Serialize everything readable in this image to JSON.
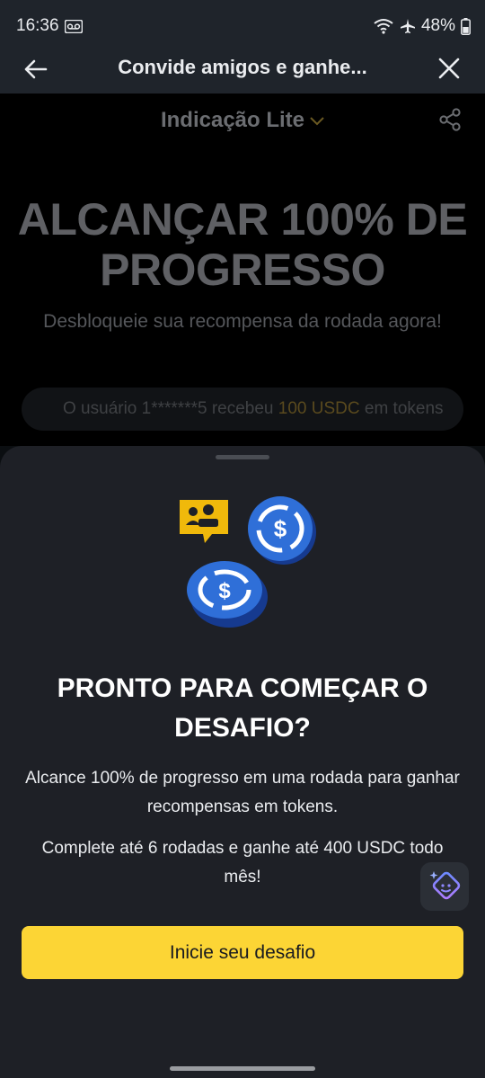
{
  "status_bar": {
    "time": "16:36",
    "battery": "48%"
  },
  "header": {
    "title": "Convide amigos e ganhe..."
  },
  "background": {
    "program_label": "Indicação Lite",
    "hero_title_line1": "ALCANÇAR 100% DE",
    "hero_title_line2": "PROGRESSO",
    "hero_subtitle": "Desbloqueie sua recompensa da rodada agora!",
    "ticker": {
      "prefix": "O usuário 1*******5 recebeu ",
      "amount": "100 USDC",
      "suffix": " em tokens"
    }
  },
  "sheet": {
    "title": "PRONTO PARA COMEÇAR O DESAFIO?",
    "desc1": "Alcance 100% de progresso em uma rodada para ganhar recompensas em tokens.",
    "desc2": "Complete até 6 rodadas e ganhe até 400 USDC todo mês!",
    "cta_label": "Inicie seu desafio"
  },
  "icons": {
    "back": "arrow-left-icon",
    "close": "close-icon",
    "share": "share-icon",
    "chevron": "chevron-down-icon",
    "assistant": "ai-assistant-icon",
    "illustration": [
      "chat-users-icon",
      "usdc-coin-icon",
      "usdc-coin-icon"
    ]
  },
  "colors": {
    "accent": "#fcd535",
    "sheet_bg": "#1e2026",
    "header_bg": "#1f242b",
    "usdc_blue": "#2f6fd8"
  }
}
